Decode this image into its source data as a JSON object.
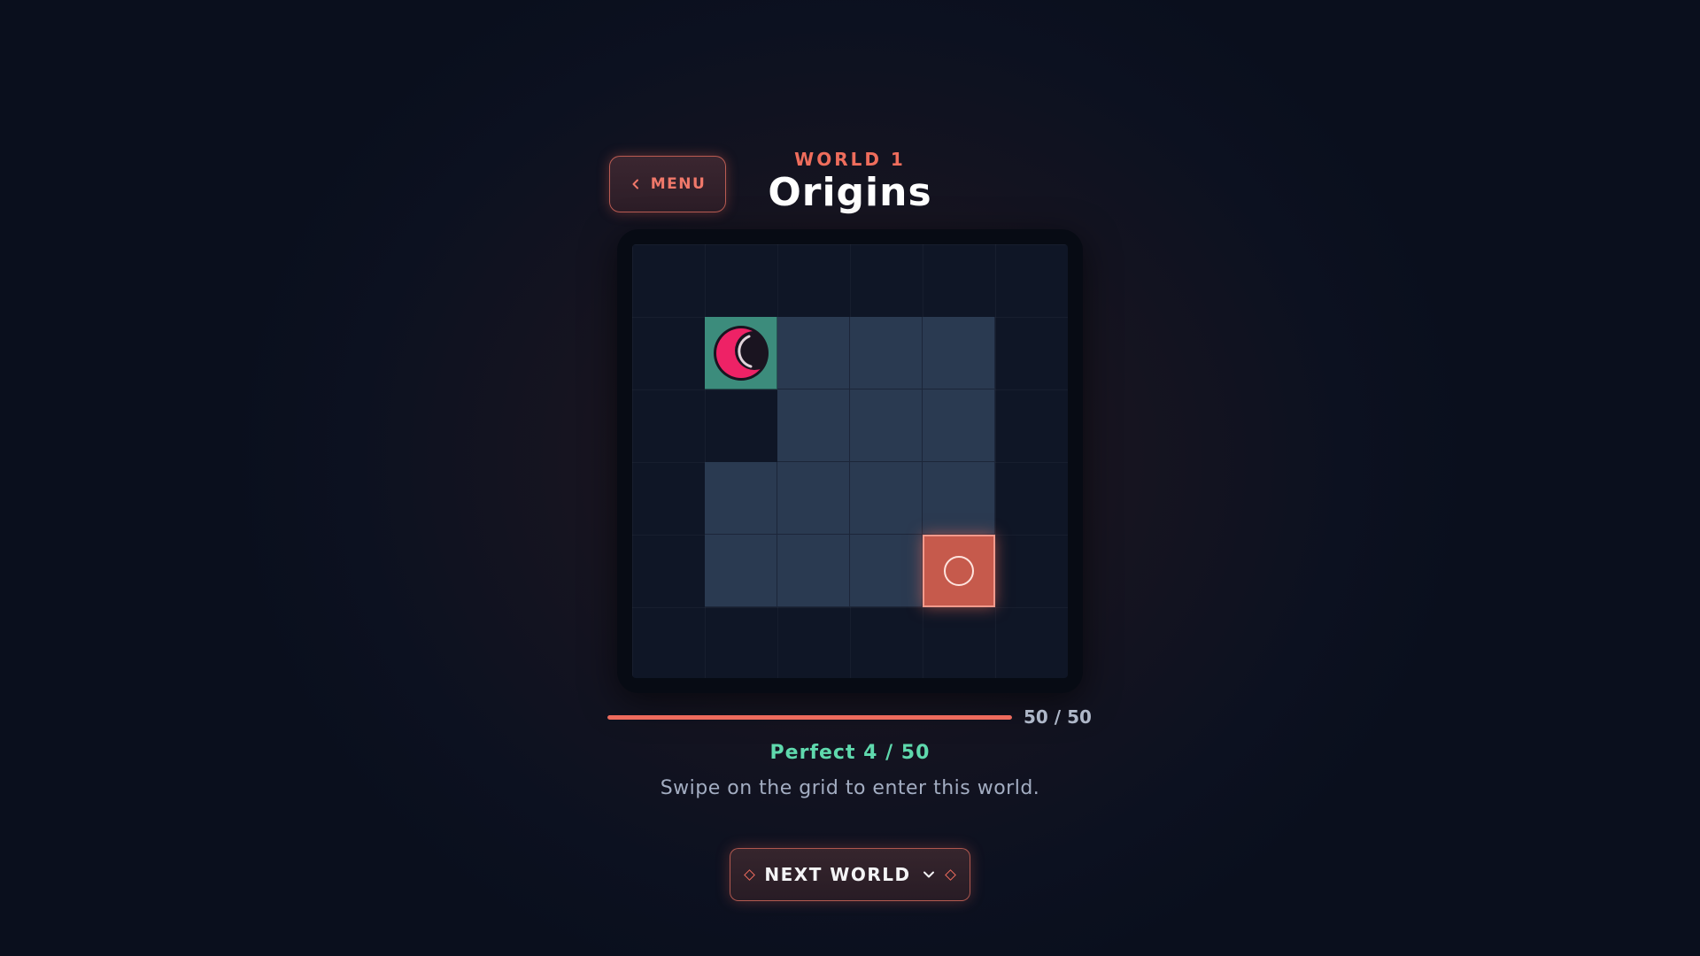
{
  "header": {
    "menu_label": "MENU",
    "world_label": "WORLD 1",
    "world_title": "Origins"
  },
  "board": {
    "cols": 6,
    "rows": 6,
    "floor_cells": [
      [
        1,
        1
      ],
      [
        2,
        1
      ],
      [
        3,
        1
      ],
      [
        4,
        1
      ],
      [
        2,
        2
      ],
      [
        3,
        2
      ],
      [
        4,
        2
      ],
      [
        1,
        3
      ],
      [
        2,
        3
      ],
      [
        3,
        3
      ],
      [
        4,
        3
      ],
      [
        1,
        4
      ],
      [
        2,
        4
      ],
      [
        3,
        4
      ],
      [
        4,
        4
      ]
    ],
    "start_cell": [
      1,
      1
    ],
    "goal_cell": [
      4,
      4
    ],
    "colors": {
      "floor": "#2a3a51",
      "start": "#3c8c7c",
      "goal": "#c65a4c",
      "player": "#ee2266"
    },
    "player_icon": "crescent-moon-icon",
    "goal_icon": "ring-icon"
  },
  "progress": {
    "completed": 50,
    "total": 50,
    "text": "50 / 50"
  },
  "perfect_text": "Perfect 4 / 50",
  "hint_text": "Swipe on the grid to enter this world.",
  "next_button": {
    "label": "NEXT WORLD",
    "icon": "chevron-down-icon"
  },
  "accent_color": "#ee6b5d"
}
